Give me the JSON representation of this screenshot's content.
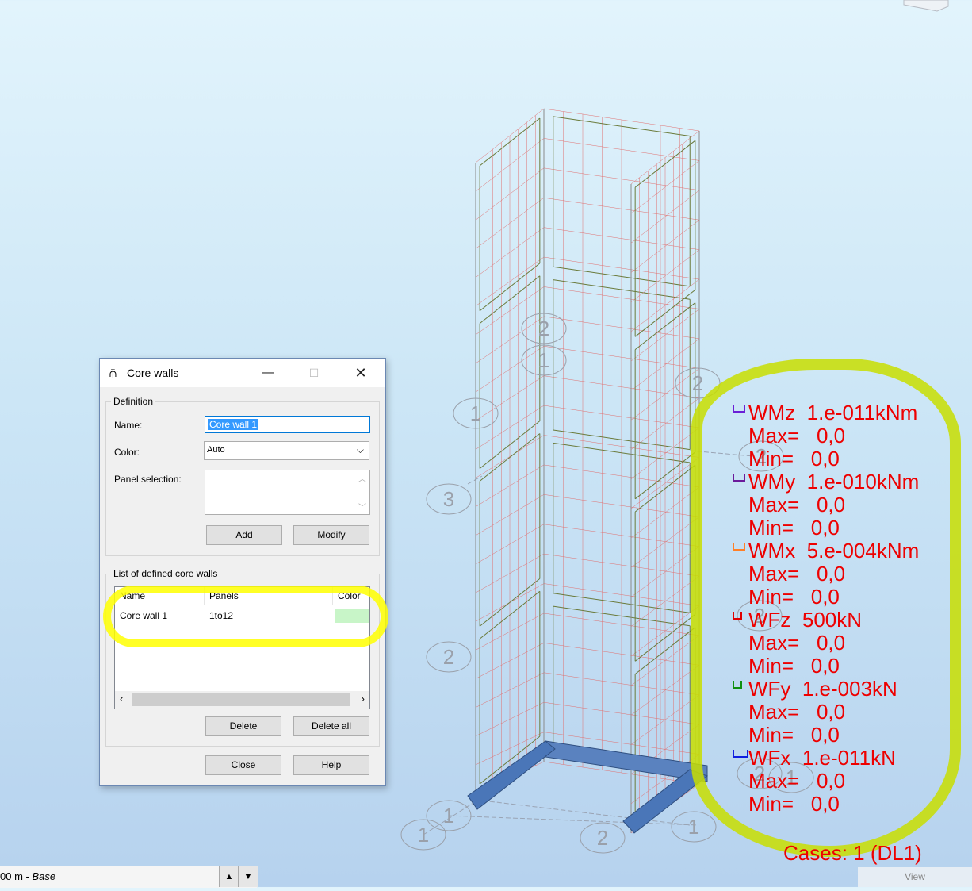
{
  "dialog": {
    "title": "Core walls",
    "window_icon": "core-wall-app-icon",
    "definition": {
      "legend": "Definition",
      "name_label": "Name:",
      "name_value": "Core wall 1",
      "color_label": "Color:",
      "color_value": "Auto",
      "panel_selection_label": "Panel selection:",
      "panel_selection_value": "",
      "add_label": "Add",
      "modify_label": "Modify"
    },
    "list": {
      "legend": "List of defined core walls",
      "columns": [
        "Name",
        "Panels",
        "Color"
      ],
      "rows": [
        {
          "name": "Core wall 1",
          "panels": "1to12",
          "color": "#c8f5c8"
        }
      ],
      "delete_label": "Delete",
      "delete_all_label": "Delete all"
    },
    "close_label": "Close",
    "help_label": "Help"
  },
  "legend": {
    "entries": [
      {
        "label": "WMz  1.e-011kNm",
        "max": "Max=   0,0",
        "min": "Min=   0,0",
        "marker_color": "#6a1fd6"
      },
      {
        "label": "WMy  1.e-010kNm",
        "max": "Max=   0,0",
        "min": "Min=   0,0",
        "marker_color": "#6b1a9b"
      },
      {
        "label": "WMx  5.e-004kNm",
        "max": "Max=   0,0",
        "min": "Min=   0,0",
        "marker_color": "#ff7f27"
      },
      {
        "label": "WFz  500kN",
        "max": "Max=   0,0",
        "min": "Min=   0,0",
        "marker_color": "#e00000"
      },
      {
        "label": "WFy  1.e-003kN",
        "max": "Max=   0,0",
        "min": "Min=   0,0",
        "marker_color": "#109010"
      },
      {
        "label": "WFx  1.e-011kN",
        "max": "Max=   0,0",
        "min": "Min=   0,0",
        "marker_color": "#1020e0"
      }
    ],
    "cases": "Cases: 1 (DL1)"
  },
  "grid_labels": [
    "2",
    "1",
    "2",
    "1",
    "3",
    "2",
    "1",
    "1",
    "2",
    "1",
    "2",
    "2",
    "1",
    "2"
  ],
  "status_bar": {
    "prefix": "00 m - ",
    "story": "Base",
    "spin_up": "▲",
    "spin_down": "▼"
  },
  "view_tab": "View",
  "colors": {
    "wire_green": "#6a7a3a",
    "wire_red": "#e07070",
    "foundation": "#4a78b8",
    "annotation": "#ee0000"
  }
}
